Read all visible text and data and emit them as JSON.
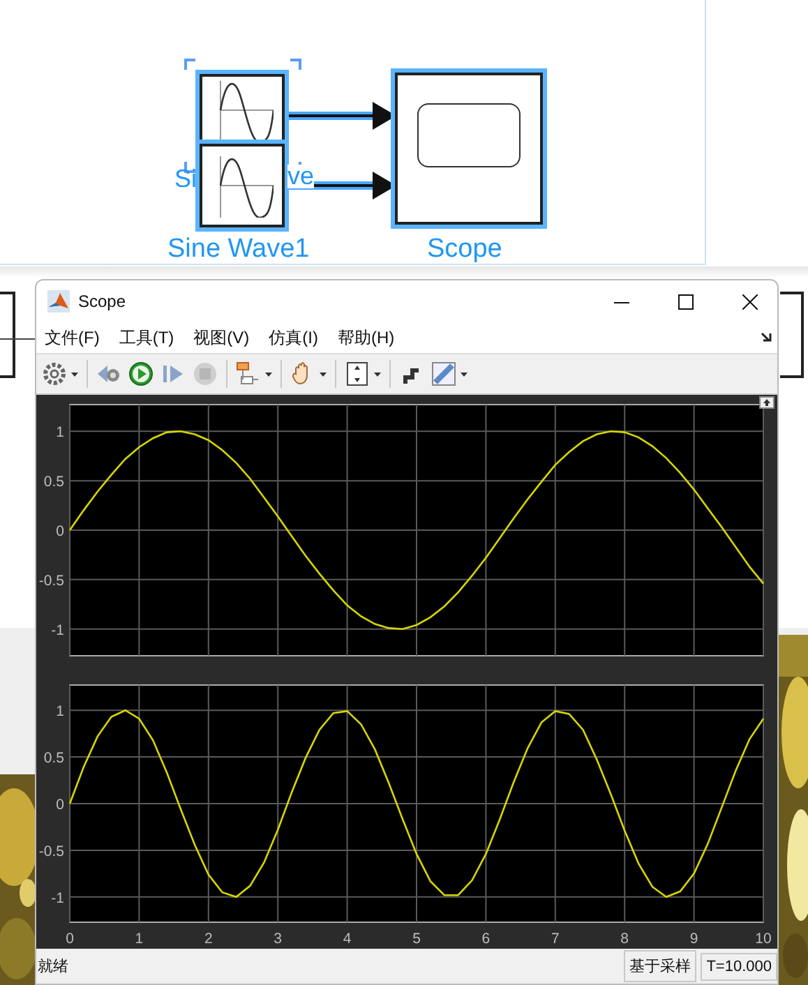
{
  "model": {
    "blocks": [
      {
        "kind": "sine",
        "visible_label_parts": [
          "Si",
          "ve"
        ],
        "selected": true
      },
      {
        "kind": "sine",
        "label": "Sine Wave1",
        "selected": true
      },
      {
        "kind": "scope",
        "label": "Scope",
        "selected": true
      }
    ]
  },
  "window": {
    "title": "Scope"
  },
  "menu": [
    "文件(F)",
    "工具(T)",
    "视图(V)",
    "仿真(I)",
    "帮助(H)"
  ],
  "toolbar": [
    {
      "kind": "gear",
      "caret": true,
      "disabled": false
    },
    {
      "kind": "sep"
    },
    {
      "kind": "step-back",
      "caret": false,
      "disabled": false
    },
    {
      "kind": "run",
      "caret": false,
      "disabled": false
    },
    {
      "kind": "step-forward",
      "caret": false,
      "disabled": false
    },
    {
      "kind": "stop",
      "caret": false,
      "disabled": true
    },
    {
      "kind": "sep"
    },
    {
      "kind": "highlight",
      "caret": true,
      "disabled": false
    },
    {
      "kind": "sep"
    },
    {
      "kind": "hand",
      "caret": true,
      "disabled": false
    },
    {
      "kind": "sep"
    },
    {
      "kind": "fit",
      "caret": true,
      "disabled": false
    },
    {
      "kind": "sep"
    },
    {
      "kind": "style",
      "caret": false,
      "disabled": false
    },
    {
      "kind": "ruler",
      "caret": true,
      "disabled": false
    }
  ],
  "plots": [
    {
      "chart_data": {
        "type": "line",
        "x": [
          0,
          0.2,
          0.4,
          0.6,
          0.8,
          1,
          1.2,
          1.4,
          1.6,
          1.8,
          2,
          2.2,
          2.4,
          2.6,
          2.8,
          3,
          3.2,
          3.4,
          3.6,
          3.8,
          4,
          4.2,
          4.4,
          4.6,
          4.8,
          5,
          5.2,
          5.4,
          5.6,
          5.8,
          6,
          6.2,
          6.4,
          6.6,
          6.8,
          7,
          7.2,
          7.4,
          7.6,
          7.8,
          8,
          8.2,
          8.4,
          8.6,
          8.8,
          9,
          9.2,
          9.4,
          9.6,
          9.8,
          10
        ],
        "xlim": [
          0,
          10
        ],
        "ylim": [
          -1.27,
          1.27
        ],
        "yticks": [
          1,
          0.5,
          0,
          -0.5,
          -1
        ],
        "grid": true,
        "series": [
          {
            "color": "#d6d600",
            "values": [
              0,
              0.2,
              0.39,
              0.56,
              0.72,
              0.84,
              0.93,
              0.99,
              1,
              0.97,
              0.91,
              0.81,
              0.68,
              0.52,
              0.33,
              0.14,
              -0.06,
              -0.26,
              -0.44,
              -0.61,
              -0.76,
              -0.87,
              -0.95,
              -0.99,
              -1,
              -0.96,
              -0.88,
              -0.77,
              -0.63,
              -0.46,
              -0.28,
              -0.08,
              0.12,
              0.31,
              0.49,
              0.66,
              0.79,
              0.9,
              0.97,
              1,
              0.99,
              0.94,
              0.85,
              0.73,
              0.58,
              0.41,
              0.22,
              0.03,
              -0.17,
              -0.37,
              -0.54
            ]
          }
        ]
      }
    },
    {
      "chart_data": {
        "type": "line",
        "x": [
          0,
          0.2,
          0.4,
          0.6,
          0.8,
          1,
          1.2,
          1.4,
          1.6,
          1.8,
          2,
          2.2,
          2.4,
          2.6,
          2.8,
          3,
          3.2,
          3.4,
          3.6,
          3.8,
          4,
          4.2,
          4.4,
          4.6,
          4.8,
          5,
          5.2,
          5.4,
          5.6,
          5.8,
          6,
          6.2,
          6.4,
          6.6,
          6.8,
          7,
          7.2,
          7.4,
          7.6,
          7.8,
          8,
          8.2,
          8.4,
          8.6,
          8.8,
          9,
          9.2,
          9.4,
          9.6,
          9.8,
          10
        ],
        "xlim": [
          0,
          10
        ],
        "ylim": [
          -1.27,
          1.27
        ],
        "yticks": [
          1,
          0.5,
          0,
          -0.5,
          -1
        ],
        "xticks": [
          0,
          1,
          2,
          3,
          4,
          5,
          6,
          7,
          8,
          9,
          10
        ],
        "grid": true,
        "series": [
          {
            "color": "#d6d600",
            "values": [
              0,
              0.39,
              0.72,
              0.93,
              1,
              0.91,
              0.68,
              0.33,
              -0.06,
              -0.44,
              -0.76,
              -0.95,
              -1,
              -0.88,
              -0.63,
              -0.28,
              0.12,
              0.49,
              0.79,
              0.97,
              0.99,
              0.85,
              0.58,
              0.22,
              -0.17,
              -0.54,
              -0.83,
              -0.98,
              -0.98,
              -0.82,
              -0.54,
              -0.17,
              0.23,
              0.59,
              0.87,
              0.99,
              0.96,
              0.79,
              0.47,
              0.1,
              -0.29,
              -0.64,
              -0.89,
              -1,
              -0.94,
              -0.75,
              -0.43,
              -0.04,
              0.35,
              0.69,
              0.91
            ]
          }
        ]
      }
    }
  ],
  "status_bar": {
    "message": "就绪",
    "mode": "基于采样",
    "time": "T=10.000"
  }
}
